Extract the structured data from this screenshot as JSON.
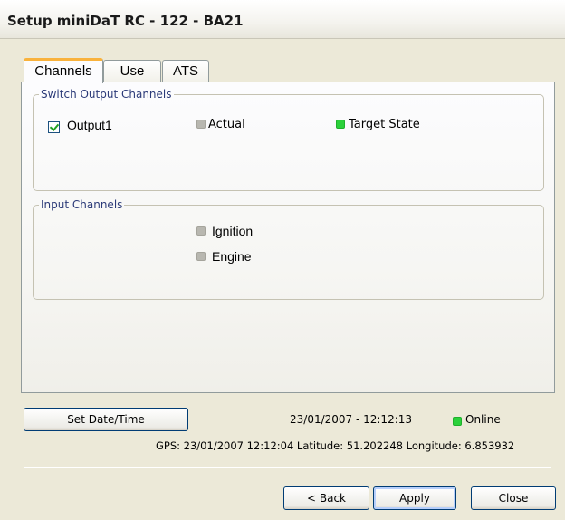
{
  "window": {
    "title": "Setup miniDaT RC - 122 - BA21"
  },
  "tabs": [
    {
      "label": "Channels",
      "active": true
    },
    {
      "label": "Use",
      "active": false
    },
    {
      "label": "ATS",
      "active": false
    }
  ],
  "switch_output": {
    "legend": "Switch Output Channels",
    "output_label": "Output1",
    "output_checked": true,
    "actual_label": "Actual",
    "actual_led": "grey",
    "target_label": "Target State",
    "target_led": "green"
  },
  "input_channels": {
    "legend": "Input Channels",
    "items": [
      {
        "label": "Ignition",
        "led": "grey"
      },
      {
        "label": "Engine",
        "led": "grey"
      }
    ]
  },
  "status": {
    "set_datetime_label": "Set Date/Time",
    "datetime": "23/01/2007 - 12:12:13",
    "online_label": "Online",
    "online_color": "#2bd13b",
    "gps_line": "GPS: 23/01/2007  12:12:04 Latitude: 51.202248 Longitude: 6.853932"
  },
  "buttons": {
    "back_label": "< Back",
    "apply_label": "Apply",
    "close_label": "Close"
  },
  "colors": {
    "background": "#ece9d8",
    "tab_highlight": "#f9b23c",
    "legend_text": "#2b3a78",
    "button_border": "#003c74"
  }
}
